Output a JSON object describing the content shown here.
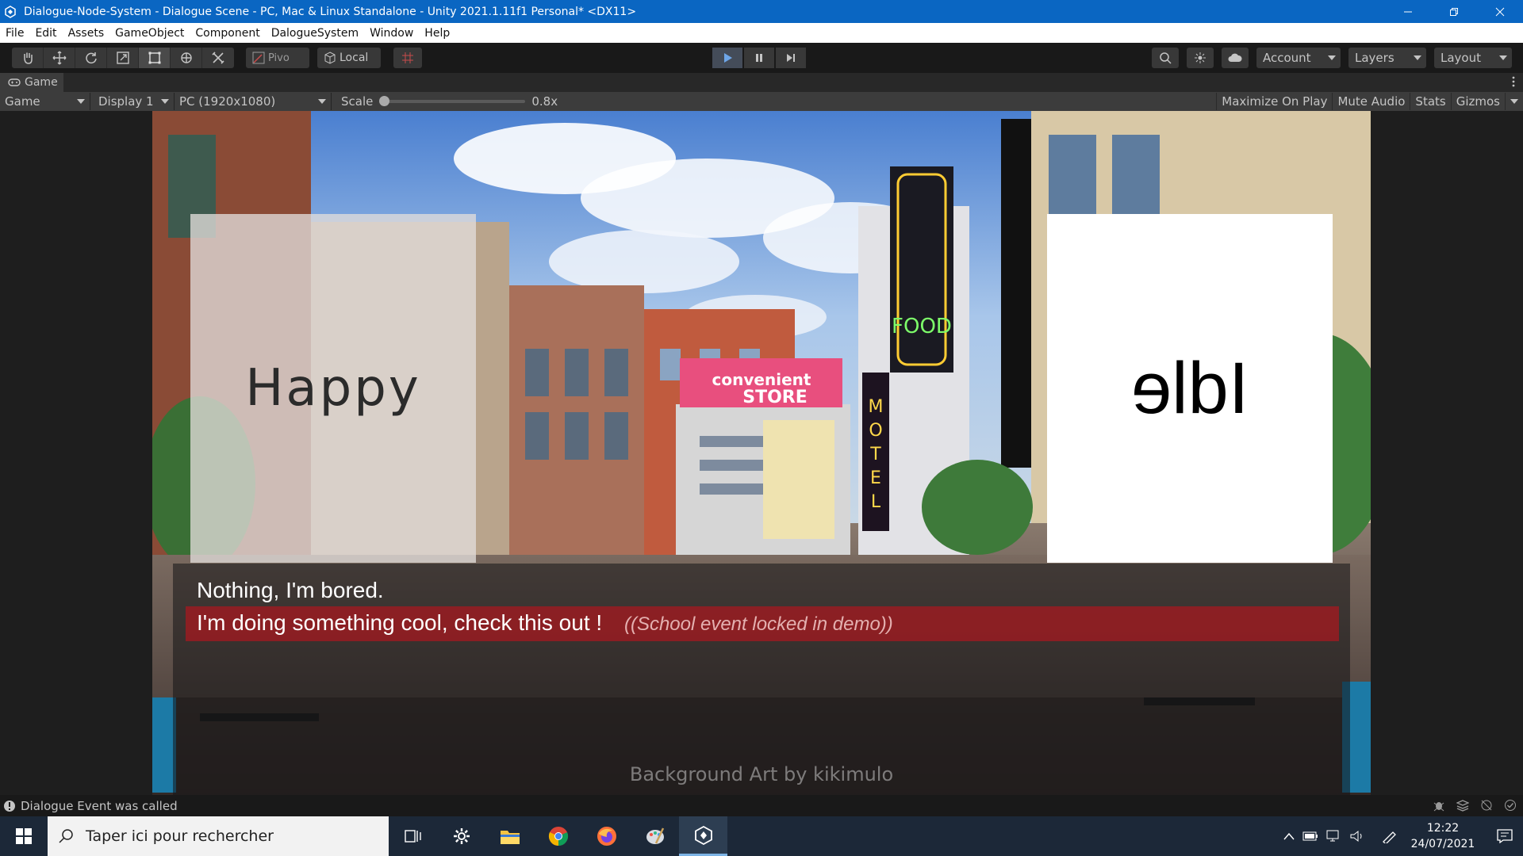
{
  "window": {
    "title": "Dialogue-Node-System - Dialogue Scene - PC, Mac & Linux Standalone - Unity 2021.1.11f1 Personal* <DX11>"
  },
  "menu": [
    "File",
    "Edit",
    "Assets",
    "GameObject",
    "Component",
    "DalogueSystem",
    "Window",
    "Help"
  ],
  "toolbar": {
    "pivot_label": "Pivo",
    "local_label": "Local",
    "account_label": "Account",
    "layers_label": "Layers",
    "layout_label": "Layout"
  },
  "game_tab": {
    "tab_label": "Game",
    "view_dropdown": "Game",
    "display_dropdown": "Display 1",
    "resolution_dropdown": "PC (1920x1080)",
    "scale_label": "Scale",
    "scale_value": "0.8x",
    "scale_fraction": 0.0,
    "toggles": [
      "Maximize On Play",
      "Mute Audio",
      "Stats",
      "Gizmos"
    ]
  },
  "game": {
    "left_portrait": "Happy",
    "right_portrait": "Idle",
    "choices": [
      {
        "text": "Nothing, I'm bored."
      },
      {
        "text": "I'm doing something cool, check this out !",
        "locked_text": "((School event locked in demo))"
      }
    ],
    "credit": "Background Art by kikimulo"
  },
  "status": {
    "message": "Dialogue Event was called"
  },
  "taskbar": {
    "search_placeholder": "Taper ici pour rechercher",
    "time": "12:22",
    "date": "24/07/2021"
  },
  "colors": {
    "title_bar": "#0a66c2",
    "editor_dark": "#191919",
    "taskbar": "#1c2838",
    "locked_choice_bar": "#aa181e"
  }
}
